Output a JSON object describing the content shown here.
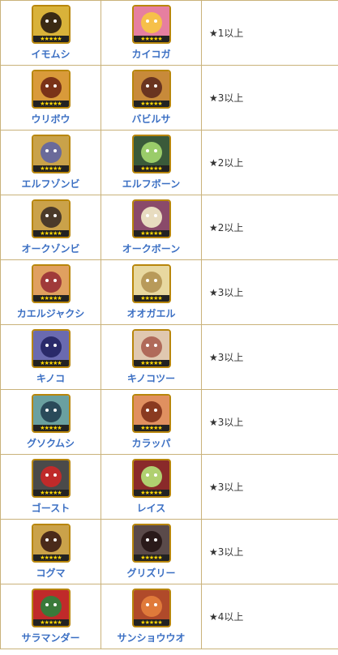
{
  "rarity_stars": "★★★★★",
  "rows": [
    {
      "from": {
        "name": "イモムシ",
        "icon": "grub-monster-icon",
        "bg": "#d9b23a",
        "fg": "#3a2a14"
      },
      "to": {
        "name": "カイコガ",
        "icon": "silkmoth-monster-icon",
        "bg": "#e67fa0",
        "fg": "#f6c04a"
      },
      "condition": "★1以上"
    },
    {
      "from": {
        "name": "ウリボウ",
        "icon": "piglet-monster-icon",
        "bg": "#d99a3a",
        "fg": "#7a3218"
      },
      "to": {
        "name": "バビルサ",
        "icon": "babirusa-monster-icon",
        "bg": "#c88a3a",
        "fg": "#6a3420"
      },
      "condition": "★3以上"
    },
    {
      "from": {
        "name": "エルフゾンビ",
        "icon": "elf-zombie-icon",
        "bg": "#c9a24a",
        "fg": "#6a6a9a"
      },
      "to": {
        "name": "エルフボーン",
        "icon": "elf-bone-icon",
        "bg": "#3a5a3a",
        "fg": "#9acc6a"
      },
      "condition": "★2以上"
    },
    {
      "from": {
        "name": "オークゾンビ",
        "icon": "orc-zombie-icon",
        "bg": "#caa24a",
        "fg": "#4a3a2a"
      },
      "to": {
        "name": "オークボーン",
        "icon": "orc-bone-icon",
        "bg": "#8a4a6a",
        "fg": "#e8dcc0"
      },
      "condition": "★2以上"
    },
    {
      "from": {
        "name": "カエルジャクシ",
        "icon": "tadpole-frog-icon",
        "bg": "#e0a060",
        "fg": "#a03a3a"
      },
      "to": {
        "name": "オオガエル",
        "icon": "giant-frog-icon",
        "bg": "#e8d8a0",
        "fg": "#b89a5a"
      },
      "condition": "★3以上"
    },
    {
      "from": {
        "name": "キノコ",
        "icon": "mushroom-monster-icon",
        "bg": "#6a6ab0",
        "fg": "#2a2a6a"
      },
      "to": {
        "name": "キノコツー",
        "icon": "mushroom-two-icon",
        "bg": "#e0c8b0",
        "fg": "#b06a5a"
      },
      "condition": "★3以上"
    },
    {
      "from": {
        "name": "グソクムシ",
        "icon": "isopod-monster-icon",
        "bg": "#6aa0a0",
        "fg": "#2a4a5a"
      },
      "to": {
        "name": "カラッパ",
        "icon": "box-crab-icon",
        "bg": "#e09060",
        "fg": "#8a3a20"
      },
      "condition": "★3以上"
    },
    {
      "from": {
        "name": "ゴースト",
        "icon": "ghost-monster-icon",
        "bg": "#4a4a4a",
        "fg": "#c02a2a"
      },
      "to": {
        "name": "レイス",
        "icon": "wraith-monster-icon",
        "bg": "#8a2a2a",
        "fg": "#b0d070"
      },
      "condition": "★3以上"
    },
    {
      "from": {
        "name": "コグマ",
        "icon": "bear-cub-icon",
        "bg": "#caa24a",
        "fg": "#4a2a1a"
      },
      "to": {
        "name": "グリズリー",
        "icon": "grizzly-bear-icon",
        "bg": "#5a4a4a",
        "fg": "#2a1a1a"
      },
      "condition": "★3以上"
    },
    {
      "from": {
        "name": "サラマンダー",
        "icon": "salamander-monster-icon",
        "bg": "#c02a2a",
        "fg": "#3a7a3a"
      },
      "to": {
        "name": "サンショウウオ",
        "icon": "giant-salamander-icon",
        "bg": "#b04a2a",
        "fg": "#e07a3a"
      },
      "condition": "★4以上"
    }
  ]
}
